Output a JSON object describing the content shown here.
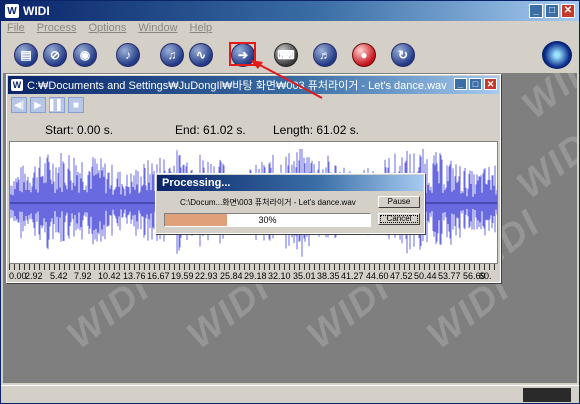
{
  "app": {
    "logo_letter": "W",
    "title": "WIDI",
    "controls": {
      "minimize": "_",
      "maximize": "□",
      "close": "✕"
    }
  },
  "menu": [
    "File",
    "Process",
    "Options",
    "Window",
    "Help"
  ],
  "toolbar": {
    "buttons": [
      {
        "name": "document-icon",
        "glyph": "▤",
        "style": "blue"
      },
      {
        "name": "no-entry-icon",
        "glyph": "⊘",
        "style": "blue"
      },
      {
        "name": "record-icon",
        "glyph": "◉",
        "style": "blue"
      },
      {
        "name": "note-slash-icon",
        "glyph": "♪",
        "style": "blue"
      },
      {
        "name": "note-slash-2-icon",
        "glyph": "♫",
        "style": "blue"
      },
      {
        "name": "wave-icon",
        "glyph": "∿",
        "style": "blue"
      },
      {
        "name": "convert-arrow-icon",
        "glyph": "➔",
        "style": "blue"
      },
      {
        "name": "midi-keyboard-icon",
        "glyph": "⌨",
        "style": "dark"
      },
      {
        "name": "piano-icon",
        "glyph": "♬",
        "style": "blue"
      },
      {
        "name": "stop-icon",
        "glyph": "●",
        "style": "red"
      },
      {
        "name": "cycle-icon",
        "glyph": "↻",
        "style": "blue"
      }
    ]
  },
  "child_window": {
    "logo_letter": "W",
    "title": "C:₩Documents and Settings₩JuDongIl₩바탕 화면₩003 퓨처라이거 - Let's dance.wav",
    "controls": {
      "minimize": "_",
      "maximize": "□",
      "close": "✕"
    },
    "transport": [
      "◀|",
      "▶",
      "▌▌",
      "■"
    ],
    "start": "Start: 0.00 s.",
    "end": "End: 61.02 s.",
    "length": "Length: 61.02 s.",
    "ruler_labels": [
      "0.00",
      "2.92",
      "5.42",
      "7.92",
      "10.42",
      "13.76",
      "16.67",
      "19.59",
      "22.93",
      "25.84",
      "29.18",
      "32.10",
      "35.01",
      "38.35",
      "41.27",
      "44.60",
      "47.52",
      "50.44",
      "53.77",
      "56.69",
      "60."
    ]
  },
  "dialog": {
    "title": "Processing...",
    "file": "C:\\Docum...화면\\003 퓨처라이거 - Let's dance.wav",
    "pause": "Pause",
    "cancel": "Cancel",
    "progress_percent": 30,
    "progress_text": "30%"
  },
  "watermark": "WIDI",
  "colors": {
    "title_bar": "#0a246a",
    "waveform": "#6a6ae0",
    "highlight": "#e21a1a",
    "progress_fill": "#e0a07a"
  }
}
